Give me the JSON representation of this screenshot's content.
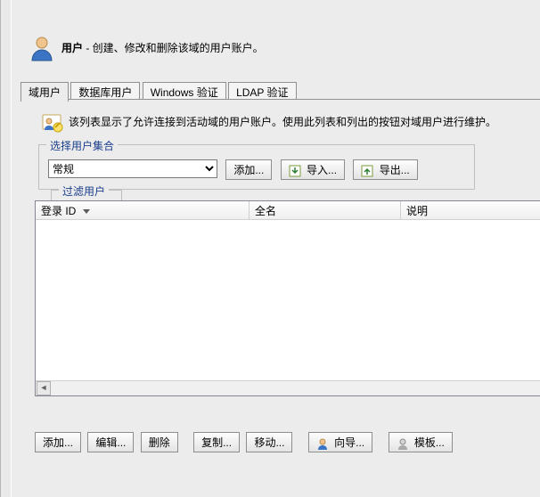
{
  "header": {
    "title_bold": "用户",
    "title_rest": " - 创建、修改和删除该域的用户账户。"
  },
  "tabs": {
    "items": [
      {
        "label": "域用户"
      },
      {
        "label": "数据库用户"
      },
      {
        "label": "Windows 验证"
      },
      {
        "label": "LDAP 验证"
      }
    ],
    "active_index": 0
  },
  "info_text": "该列表显示了允许连接到活动域的用户账户。使用此列表和列出的按钮对域用户进行维护。",
  "groupbox_select": {
    "legend": "选择用户集合",
    "combo_value": "常规",
    "add_btn": "添加...",
    "import_btn": "导入...",
    "export_btn": "导出..."
  },
  "groupbox_filter": {
    "legend": "过滤用户"
  },
  "table": {
    "columns": [
      {
        "label": "登录 ID"
      },
      {
        "label": "全名"
      },
      {
        "label": "说明"
      }
    ]
  },
  "bottom_buttons": {
    "add": "添加...",
    "edit": "编辑...",
    "delete": "删除",
    "copy": "复制...",
    "move": "移动...",
    "wizard": "向导...",
    "template": "模板..."
  },
  "icons": {
    "user_large": "user-icon",
    "user_sheet": "user-sheet-icon",
    "import": "import-icon",
    "export": "export-icon",
    "wizard_user": "wizard-user-icon",
    "template": "template-icon"
  }
}
